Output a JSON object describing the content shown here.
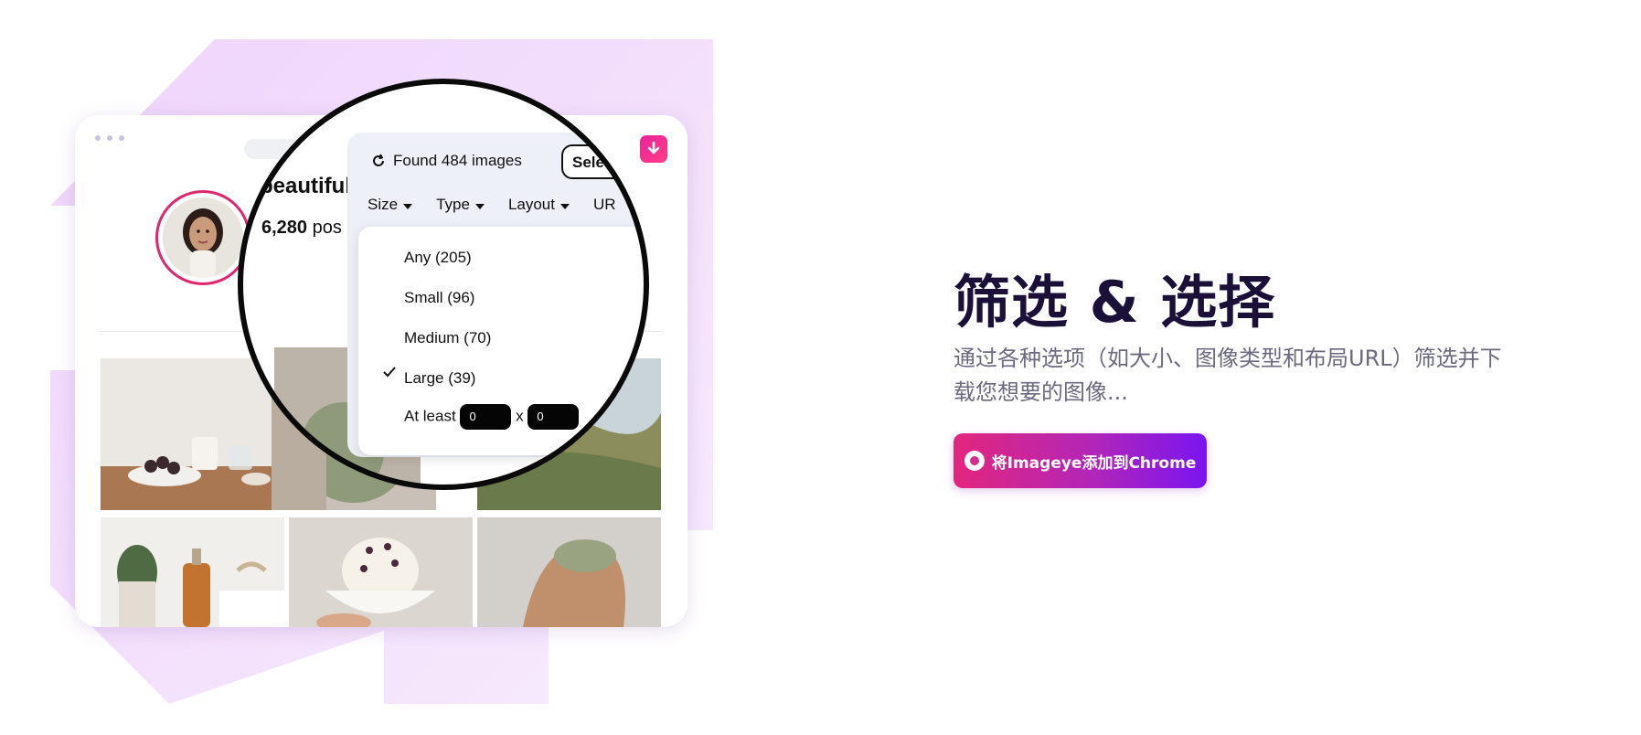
{
  "mockup": {
    "profile_name": "beautiful",
    "posts_count": "6,280",
    "posts_label": "pos"
  },
  "panel": {
    "found_text": "Found 484 images",
    "select_label": "Sele",
    "filters": [
      "Size",
      "Type",
      "Layout",
      "UR"
    ],
    "size_dropdown": {
      "items": [
        "Any (205)",
        "Small (96)",
        "Medium (70)",
        "Large (39)"
      ],
      "selected": "Large (39)",
      "at_least_label": "At least",
      "width_value": "0",
      "times": "x",
      "height_value": "0"
    }
  },
  "hero": {
    "headline": "筛选 & 选择",
    "description": "通过各种选项（如大小、图像类型和布局URL）筛选并下载您想要的图像...",
    "cta_label": "将Imageye添加到Chrome"
  },
  "icons": [
    "refresh-icon",
    "download-icon",
    "check-icon",
    "chrome-icon",
    "caret-down-icon"
  ],
  "colors": {
    "accent_pink": "#e3267e",
    "accent_purple": "#7a15f0",
    "headline": "#1a1038",
    "deco_lavender": "#f1defb"
  }
}
